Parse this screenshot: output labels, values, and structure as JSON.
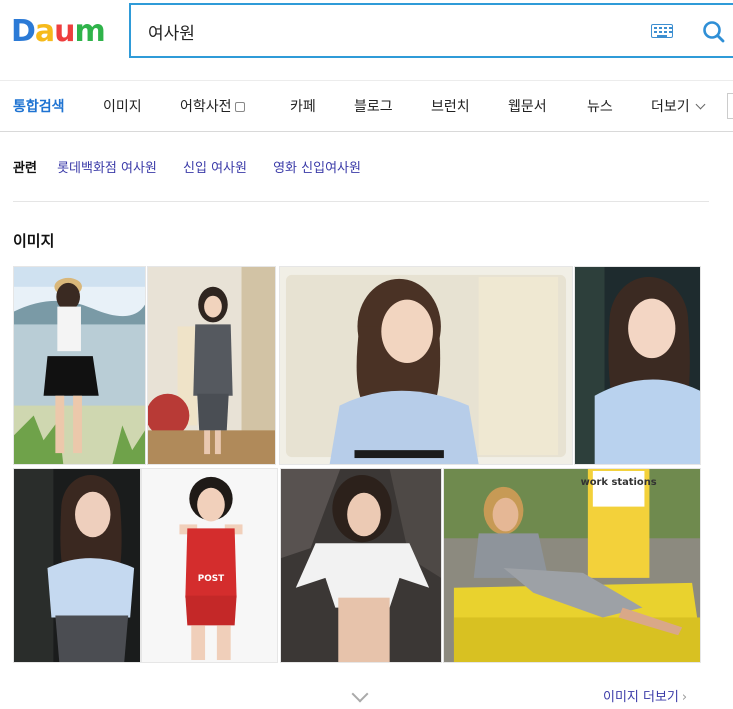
{
  "logo": {
    "letters": [
      "D",
      "a",
      "u",
      "m"
    ],
    "colors": [
      "#2b7ad6",
      "#f6ba1b",
      "#ee3e3e",
      "#2fb34a"
    ]
  },
  "search": {
    "query": "여사원"
  },
  "tabs": [
    {
      "label": "통합검색",
      "active": true
    },
    {
      "label": "이미지"
    },
    {
      "label": "어학사전"
    },
    {
      "label": "카페"
    },
    {
      "label": "블로그"
    },
    {
      "label": "브런치"
    },
    {
      "label": "웹문서"
    },
    {
      "label": "뉴스"
    },
    {
      "label": "더보기"
    }
  ],
  "related": {
    "title": "관련",
    "links": [
      "롯데백화점 여사원",
      "신입 여사원",
      "영화 신입여사원"
    ]
  },
  "images_section": {
    "title": "이미지",
    "tiles": [
      {
        "overlay_text": ""
      },
      {
        "overlay_text": ""
      },
      {
        "overlay_text": ""
      },
      {
        "overlay_text": ""
      },
      {
        "overlay_text": ""
      },
      {
        "overlay_text": "POST"
      },
      {
        "overlay_text": ""
      },
      {
        "overlay_text": "work stations"
      }
    ],
    "more_label": "이미지 더보기",
    "more_arrow": "›"
  },
  "colors": {
    "accent": "#1e73d2",
    "search_border": "#2f9bd8",
    "link": "#3b3ba8"
  }
}
